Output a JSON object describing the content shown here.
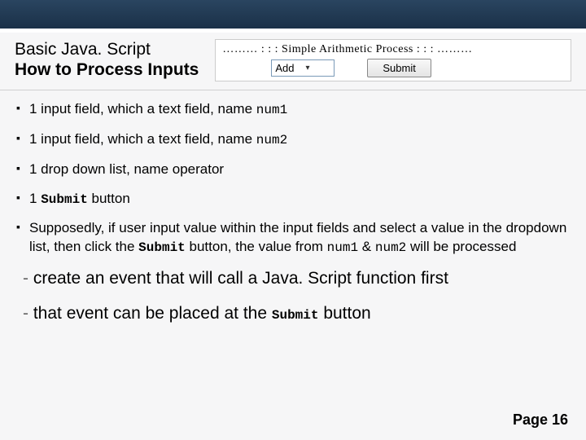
{
  "title": {
    "line1": "Basic Java. Script",
    "line2": "How to Process Inputs"
  },
  "inset": {
    "caption": "……… : : :  Simple Arithmetic Process : : : ………",
    "dropdown_value": "Add",
    "submit_label": "Submit"
  },
  "bullets": [
    {
      "pre": "1 input field, which a text field, name ",
      "code": "num1",
      "post": ""
    },
    {
      "pre": "1 input field, which a text field, name ",
      "code": "num2",
      "post": ""
    },
    {
      "pre": "1 drop down list, name operator",
      "code": "",
      "post": ""
    },
    {
      "pre": "1 ",
      "code": "Submit",
      "post": " button",
      "boldcode": true
    }
  ],
  "para": {
    "t1": "Supposedly, if user input value within the input fields and select a value in the dropdown list, then click the ",
    "c1": "Submit",
    "t2": " button, the value from ",
    "c2": "num1",
    "t3": " & ",
    "c3": "num2",
    "t4": " will be processed"
  },
  "subs": [
    {
      "text": "create an event that will call a Java. Script function first"
    },
    {
      "t1": "that event can be placed at the ",
      "c1": "Submit",
      "t2": " button"
    }
  ],
  "page": "Page 16"
}
